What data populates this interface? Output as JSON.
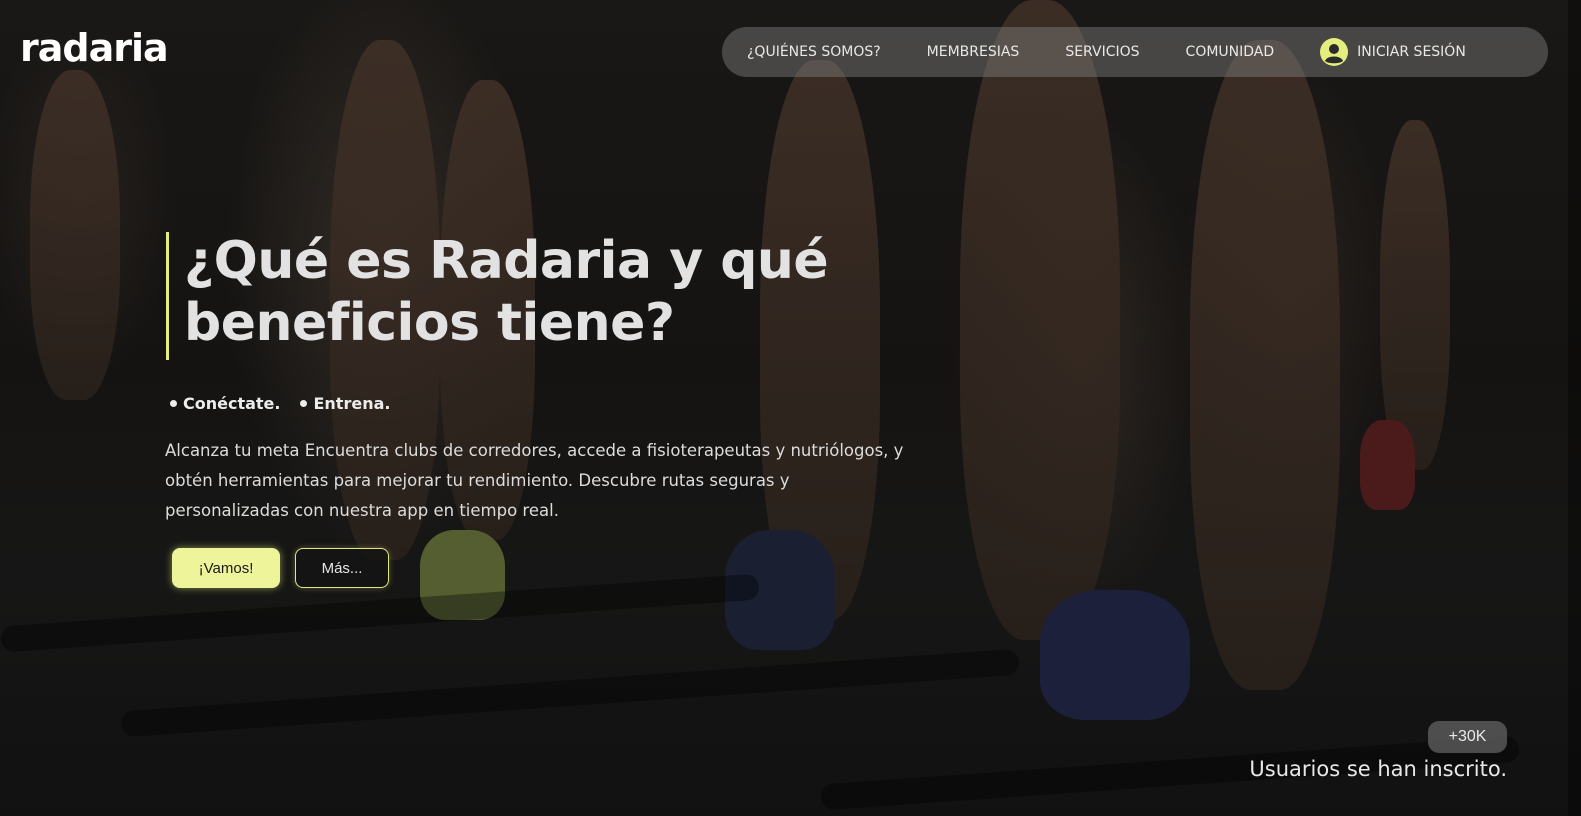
{
  "header": {
    "logo_text": "radaria",
    "nav": {
      "items": [
        {
          "label": "¿QUIÉNES SOMOS?"
        },
        {
          "label": "MEMBRESIAS"
        },
        {
          "label": "SERVICIOS"
        },
        {
          "label": "COMUNIDAD"
        }
      ],
      "login": {
        "label": "INICIAR SESIÓN",
        "icon": "user-circle-icon"
      }
    }
  },
  "hero": {
    "title_line1": "¿Qué es Radaria y qué",
    "title_line2": "beneficios tiene?",
    "bullets": [
      "Conéctate.",
      "Entrena."
    ],
    "description": "Alcanza tu meta Encuentra clubs de corredores, accede a fisioterapeutas y nutriólogos, y obtén herramientas para mejorar tu rendimiento. Descubre rutas seguras y personalizadas con nuestra app en tiempo real.",
    "primary_button": "¡Vamos!",
    "secondary_button": "Más..."
  },
  "stats": {
    "count": "+30K",
    "label": "Usuarios se han inscrito."
  },
  "colors": {
    "accent": "#e4ee7c",
    "primary_button_bg": "#eef49a",
    "nav_bg": "rgba(128,128,128,0.45)"
  }
}
